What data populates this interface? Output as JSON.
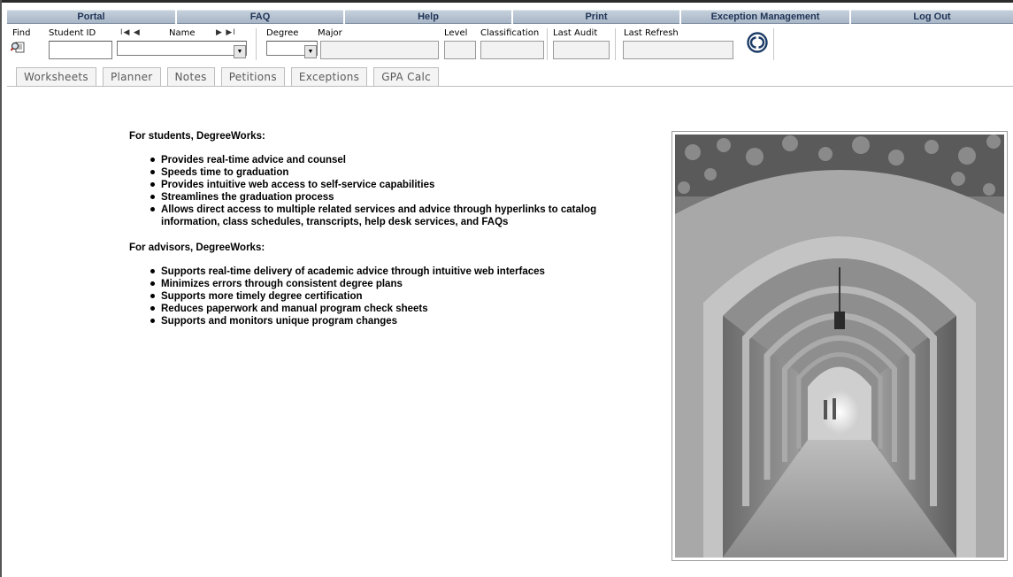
{
  "topnav": {
    "items": [
      "Portal",
      "FAQ",
      "Help",
      "Print",
      "Exception Management",
      "Log Out"
    ]
  },
  "header": {
    "find_label": "Find",
    "student_id_label": "Student ID",
    "name_label": "Name",
    "degree_label": "Degree",
    "major_label": "Major",
    "level_label": "Level",
    "classification_label": "Classification",
    "last_audit_label": "Last Audit",
    "last_refresh_label": "Last Refresh",
    "student_id_value": "",
    "name_value": "",
    "degree_value": "",
    "nav_prev": "I◀ ◀",
    "nav_next": "▶ ▶I"
  },
  "tabs": [
    "Worksheets",
    "Planner",
    "Notes",
    "Petitions",
    "Exceptions",
    "GPA Calc"
  ],
  "content": {
    "students_heading": "For students, DegreeWorks:",
    "students_points": [
      "Provides real-time advice and counsel",
      "Speeds time to graduation",
      "Provides intuitive web access to self-service capabilities",
      "Streamlines the graduation process",
      "Allows direct access to multiple related services and advice through hyperlinks to catalog information, class schedules, transcripts, help desk services, and FAQs"
    ],
    "advisors_heading": "For advisors, DegreeWorks:",
    "advisors_points": [
      "Supports real-time delivery of academic advice through intuitive web interfaces",
      "Minimizes errors through consistent degree plans",
      "Supports more timely degree certification",
      "Reduces paperwork and manual program check sheets",
      "Supports and monitors unique program changes"
    ]
  },
  "colors": {
    "nav_bg": "#b4c1d0",
    "nav_text": "#1f3355",
    "tab_bg": "#f4f4f4",
    "tab_text": "#5a5a5a"
  }
}
